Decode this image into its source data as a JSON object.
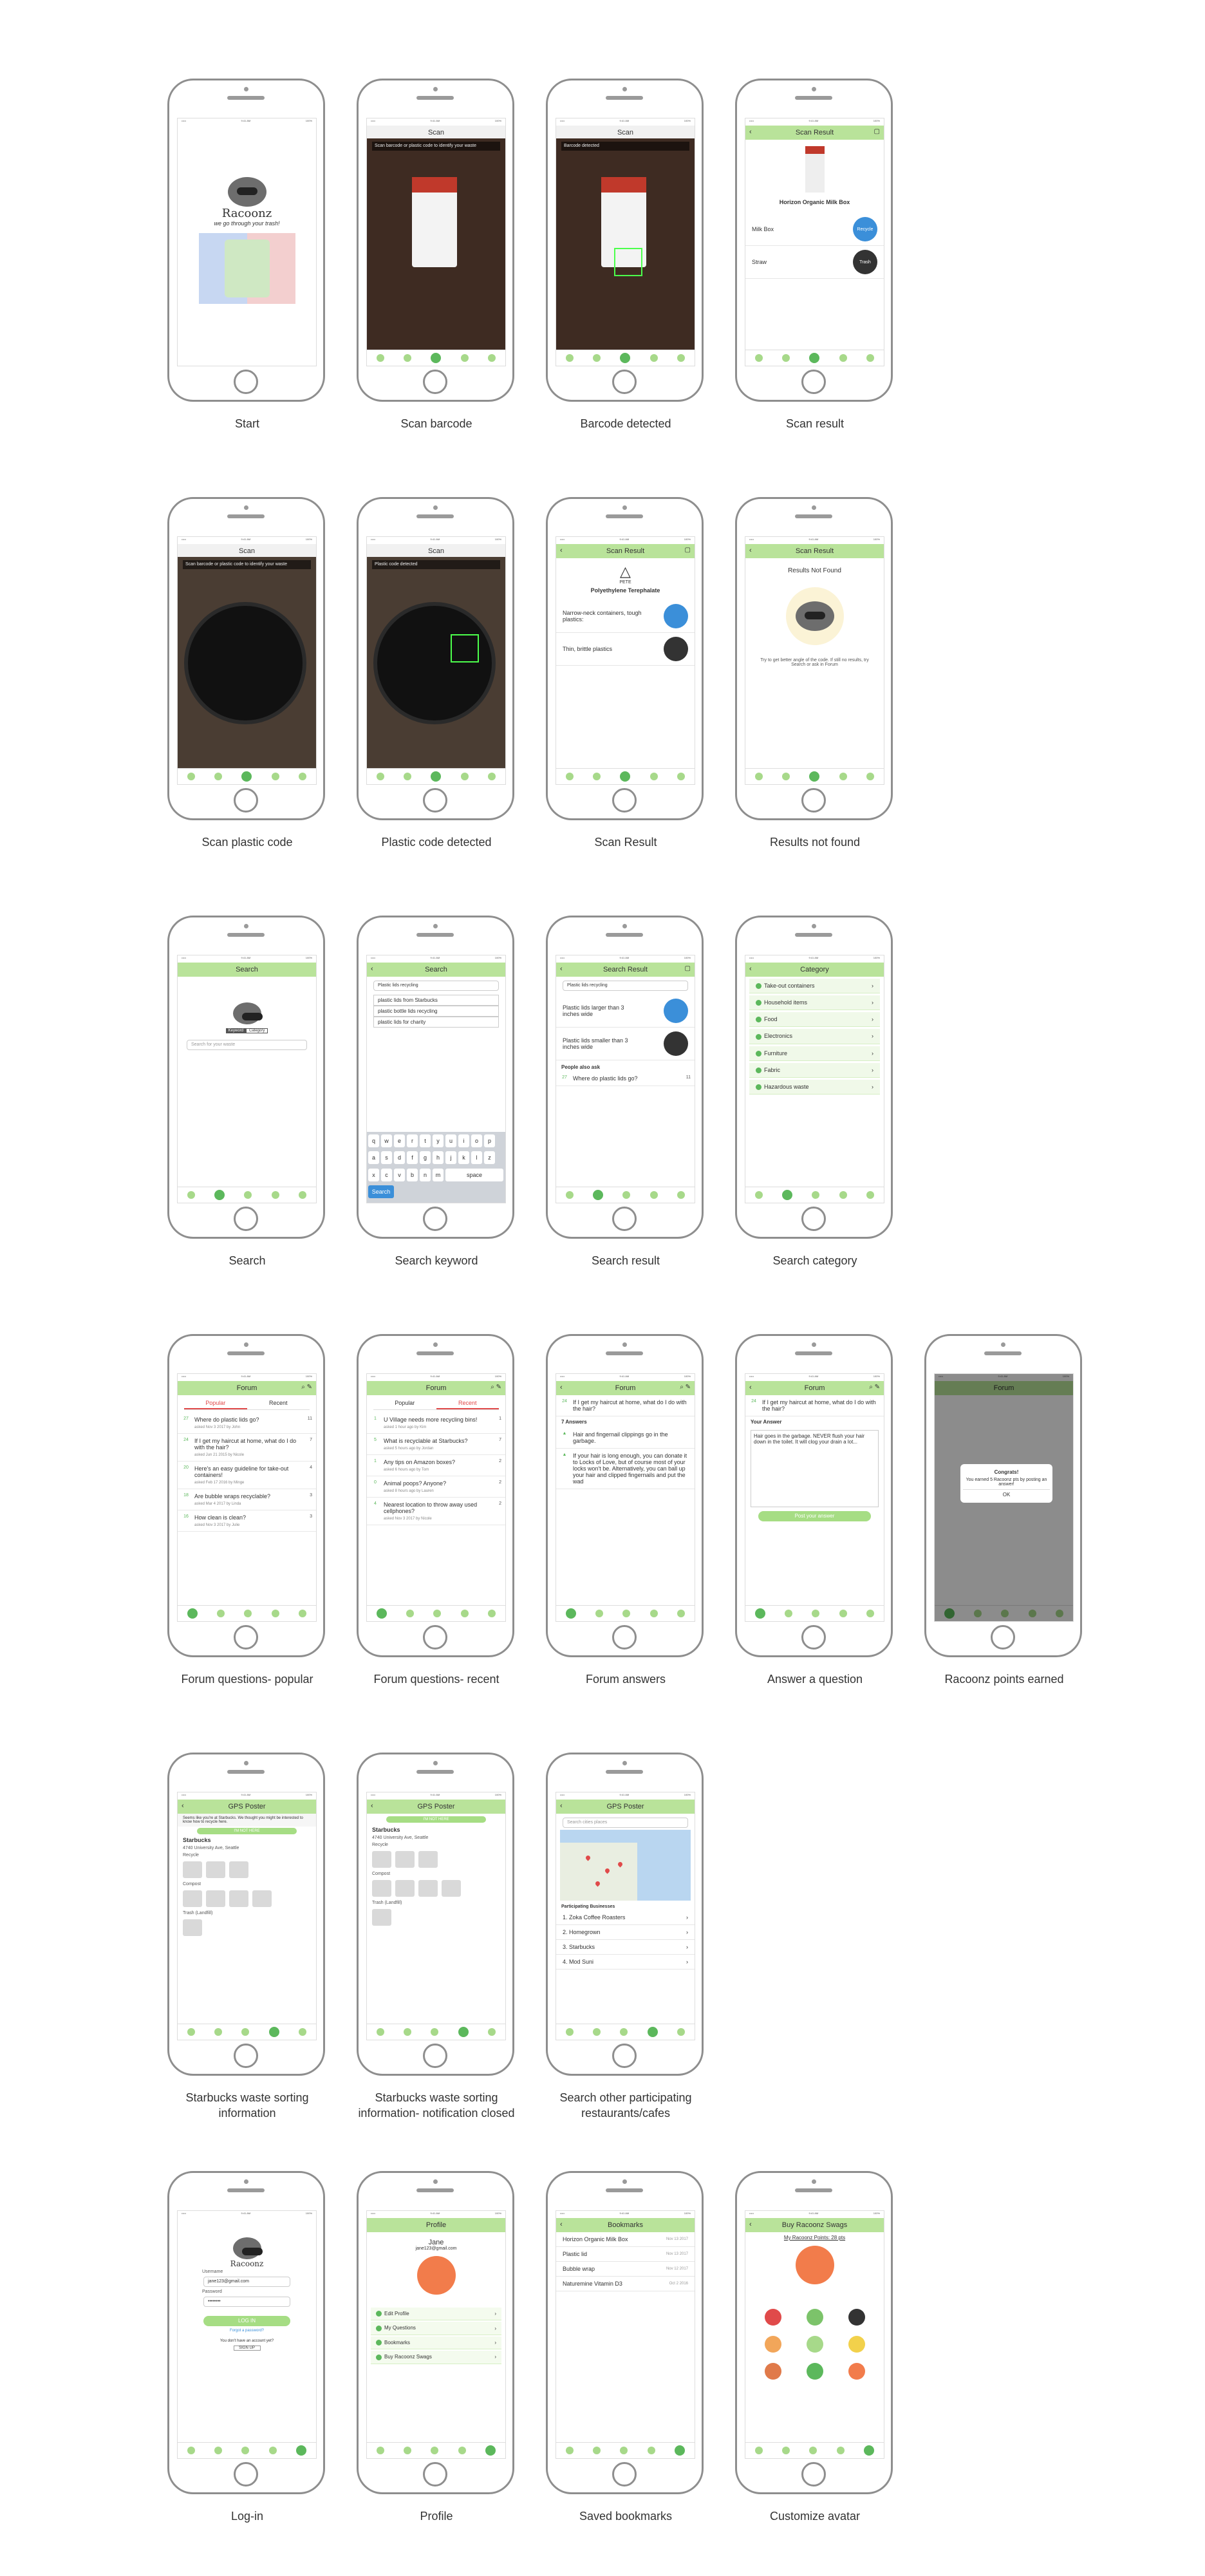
{
  "status": {
    "carrier": "•••••",
    "time": "9:41 AM",
    "battery": "100%"
  },
  "tabs": [
    "Home",
    "Search",
    "Scan",
    "GPS Poster",
    "Profile"
  ],
  "screens": {
    "start": {
      "caption": "Start",
      "logo": "Racoonz",
      "tagline": "we go through your trash!"
    },
    "scan_barcode": {
      "caption": "Scan barcode",
      "title": "Scan",
      "banner": "Scan barcode or plastic code to identify your waste"
    },
    "barcode_detected": {
      "caption": "Barcode detected",
      "title": "Scan",
      "banner": "Barcode detected"
    },
    "scan_result": {
      "caption": "Scan result",
      "title": "Scan Result",
      "product": "Horizon Organic Milk Box",
      "items": [
        {
          "name": "Milk Box",
          "bin": "Recycle",
          "color": "blue"
        },
        {
          "name": "Straw",
          "bin": "Trash",
          "color": "black"
        }
      ]
    },
    "scan_plastic": {
      "caption": "Scan plastic code",
      "title": "Scan",
      "banner": "Scan barcode or plastic code to identify your waste"
    },
    "plastic_detected": {
      "caption": "Plastic code detected",
      "title": "Scan",
      "banner": "Plastic code detected"
    },
    "scan_result2": {
      "caption": "Scan Result",
      "title": "Scan Result",
      "code": "PETE",
      "material": "Polyethylene Terephalate",
      "recycle_text": "Narrow-neck containers, tough plastics:",
      "trash_text": "Thin, brittle plastics"
    },
    "not_found": {
      "caption": "Results not found",
      "title": "Scan Result",
      "heading": "Results Not Found",
      "hint": "Try to get better angle of the code. If still no results, try Search or ask in Forum"
    },
    "search": {
      "caption": "Search",
      "title": "Search",
      "seg": [
        "Keyword",
        "Category"
      ],
      "placeholder": "Search for your waste"
    },
    "search_keyword": {
      "caption": "Search keyword",
      "title": "Search",
      "query": "Plastic lids recycling",
      "suggestions": [
        "plastic lids from Starbucks",
        "plastic bottle lids recycling",
        "plastic lids for charity"
      ],
      "keys": [
        "q",
        "w",
        "e",
        "r",
        "t",
        "y",
        "u",
        "i",
        "o",
        "p",
        "a",
        "s",
        "d",
        "f",
        "g",
        "h",
        "j",
        "k",
        "l",
        "z",
        "x",
        "c",
        "v",
        "b",
        "n",
        "m"
      ],
      "space": "space",
      "go": "Search"
    },
    "search_result": {
      "caption": "Search result",
      "title": "Search Result",
      "query": "Plastic lids recycling",
      "r1": "Plastic lids larger than 3 inches wide",
      "r2": "Plastic lids smaller than 3 inches wide",
      "also": "People also ask",
      "q": "Where do plastic lids go?",
      "votes": "27",
      "count": "11"
    },
    "category": {
      "caption": "Search category",
      "title": "Category",
      "items": [
        "Take-out containers",
        "Household items",
        "Food",
        "Electronics",
        "Furniture",
        "Fabric",
        "Hazardous waste"
      ]
    },
    "forum_popular": {
      "caption": "Forum questions- popular",
      "title": "Forum",
      "seg": [
        "Popular",
        "Recent"
      ],
      "questions": [
        {
          "v": "27",
          "t": "Where do plastic lids go?",
          "m": "asked Nov 3 2017 by John",
          "c": "11"
        },
        {
          "v": "24",
          "t": "If I get my haircut at home, what do I do with the hair?",
          "m": "asked Jun 21 2015 by Nicole",
          "c": "7"
        },
        {
          "v": "20",
          "t": "Here's an easy guideline for take-out containers!",
          "m": "asked Feb 17 2016 by Minge",
          "c": "4"
        },
        {
          "v": "18",
          "t": "Are bubble wraps recyclable?",
          "m": "asked Mar 4 2017 by Linda",
          "c": "3"
        },
        {
          "v": "16",
          "t": "How clean is clean?",
          "m": "asked Nov 3 2017 by Julie",
          "c": "3"
        }
      ]
    },
    "forum_recent": {
      "caption": "Forum questions- recent",
      "title": "Forum",
      "seg": [
        "Popular",
        "Recent"
      ],
      "questions": [
        {
          "v": "1",
          "t": "U Village needs more recycling bins!",
          "m": "asked 1 hour ago by Kim",
          "c": "1"
        },
        {
          "v": "5",
          "t": "What is recyclable at Starbucks?",
          "m": "asked 5 hours ago by Jordan",
          "c": "7"
        },
        {
          "v": "1",
          "t": "Any tips on Amazon boxes?",
          "m": "asked 6 hours ago by Tom",
          "c": "2"
        },
        {
          "v": "0",
          "t": "Animal poops? Anyone?",
          "m": "asked 8 hours ago by Lauren",
          "c": "2"
        },
        {
          "v": "4",
          "t": "Nearest location to throw away used cellphones?",
          "m": "asked Nov 3 2017 by Nicole",
          "c": "2"
        }
      ]
    },
    "forum_answers": {
      "caption": "Forum answers",
      "title": "Forum",
      "q": "If I get my haircut at home, what do I do with the hair?",
      "votes": "24",
      "answers_label": "7 Answers",
      "a1": "Hair and fingernail clippings go in the garbage.",
      "a2": "If your hair is long enough, you can donate it to Locks of Love, but of course most of your locks won't be. Alternatively, you can ball up your hair and clipped fingernails and put the wad"
    },
    "answer_q": {
      "caption": "Answer a question",
      "title": "Forum",
      "q": "If I get my haircut at home, what do I do with the hair?",
      "label": "Your Answer",
      "text": "Hair goes in the garbage. NEVER flush your hair down in the toilet. It will clog your drain a lot...",
      "btn": "Post your answer"
    },
    "points": {
      "caption": "Racoonz points earned",
      "title": "Forum",
      "head": "Congrats!",
      "body": "You earned 5 Racoonz pts by posting an answer!",
      "ok": "OK"
    },
    "starbucks": {
      "caption": "Starbucks waste sorting information",
      "title": "GPS Poster",
      "notice": "Seems like you're at Starbucks. We thought you might be interested to know how to recycle here.",
      "notice_btn": "I'M NOT HERE",
      "place": "Starbucks",
      "addr": "4740 University Ave, Seattle",
      "recycle": "Recycle",
      "compost": "Compost",
      "trash": "Trash (Landfill)"
    },
    "starbucks_closed": {
      "caption": "Starbucks waste sorting information- notification closed",
      "title": "GPS Poster",
      "btn": "I'M NOT HERE",
      "place": "Starbucks",
      "addr": "4740 University Ave, Seattle",
      "recycle": "Recycle",
      "compost": "Compost",
      "trash": "Trash (Landfill)"
    },
    "gps_search": {
      "caption": "Search other participating restaurants/cafes",
      "title": "GPS Poster",
      "placeholder": "Search cities places",
      "header": "Participating Businesses",
      "list": [
        "1. Zoka Coffee Roasters",
        "2. Homegrown",
        "3. Starbucks",
        "4. Mod Suni"
      ]
    },
    "login": {
      "caption": "Log-in",
      "logo": "Racoonz",
      "user_label": "Username",
      "user": "jane123@gmail.com",
      "pw_label": "Password",
      "pw": "••••••••",
      "login": "LOG IN",
      "forgot": "Forgot a password?",
      "noacct": "You don't have an account yet?",
      "signup": "SIGN UP"
    },
    "profile": {
      "caption": "Profile",
      "title": "Profile",
      "name": "Jane",
      "email": "jane123@gmail.com",
      "menu": [
        "Edit Profile",
        "My Questions",
        "Bookmarks",
        "Buy Racoonz Swags"
      ]
    },
    "bookmarks": {
      "caption": "Saved bookmarks",
      "title": "Bookmarks",
      "items": [
        {
          "n": "Horizon Organic Milk Box",
          "d": "Nov 13 2017"
        },
        {
          "n": "Plastic lid",
          "d": "Nov 13 2017"
        },
        {
          "n": "Bubble wrap",
          "d": "Nov 12 2017"
        },
        {
          "n": "Naturemine Vitamin D3",
          "d": "Oct 2 2016"
        }
      ]
    },
    "swags": {
      "caption": "Customize avatar",
      "title": "Buy Racoonz Swags",
      "points": "My Racoonz Points: 28 pts"
    }
  }
}
